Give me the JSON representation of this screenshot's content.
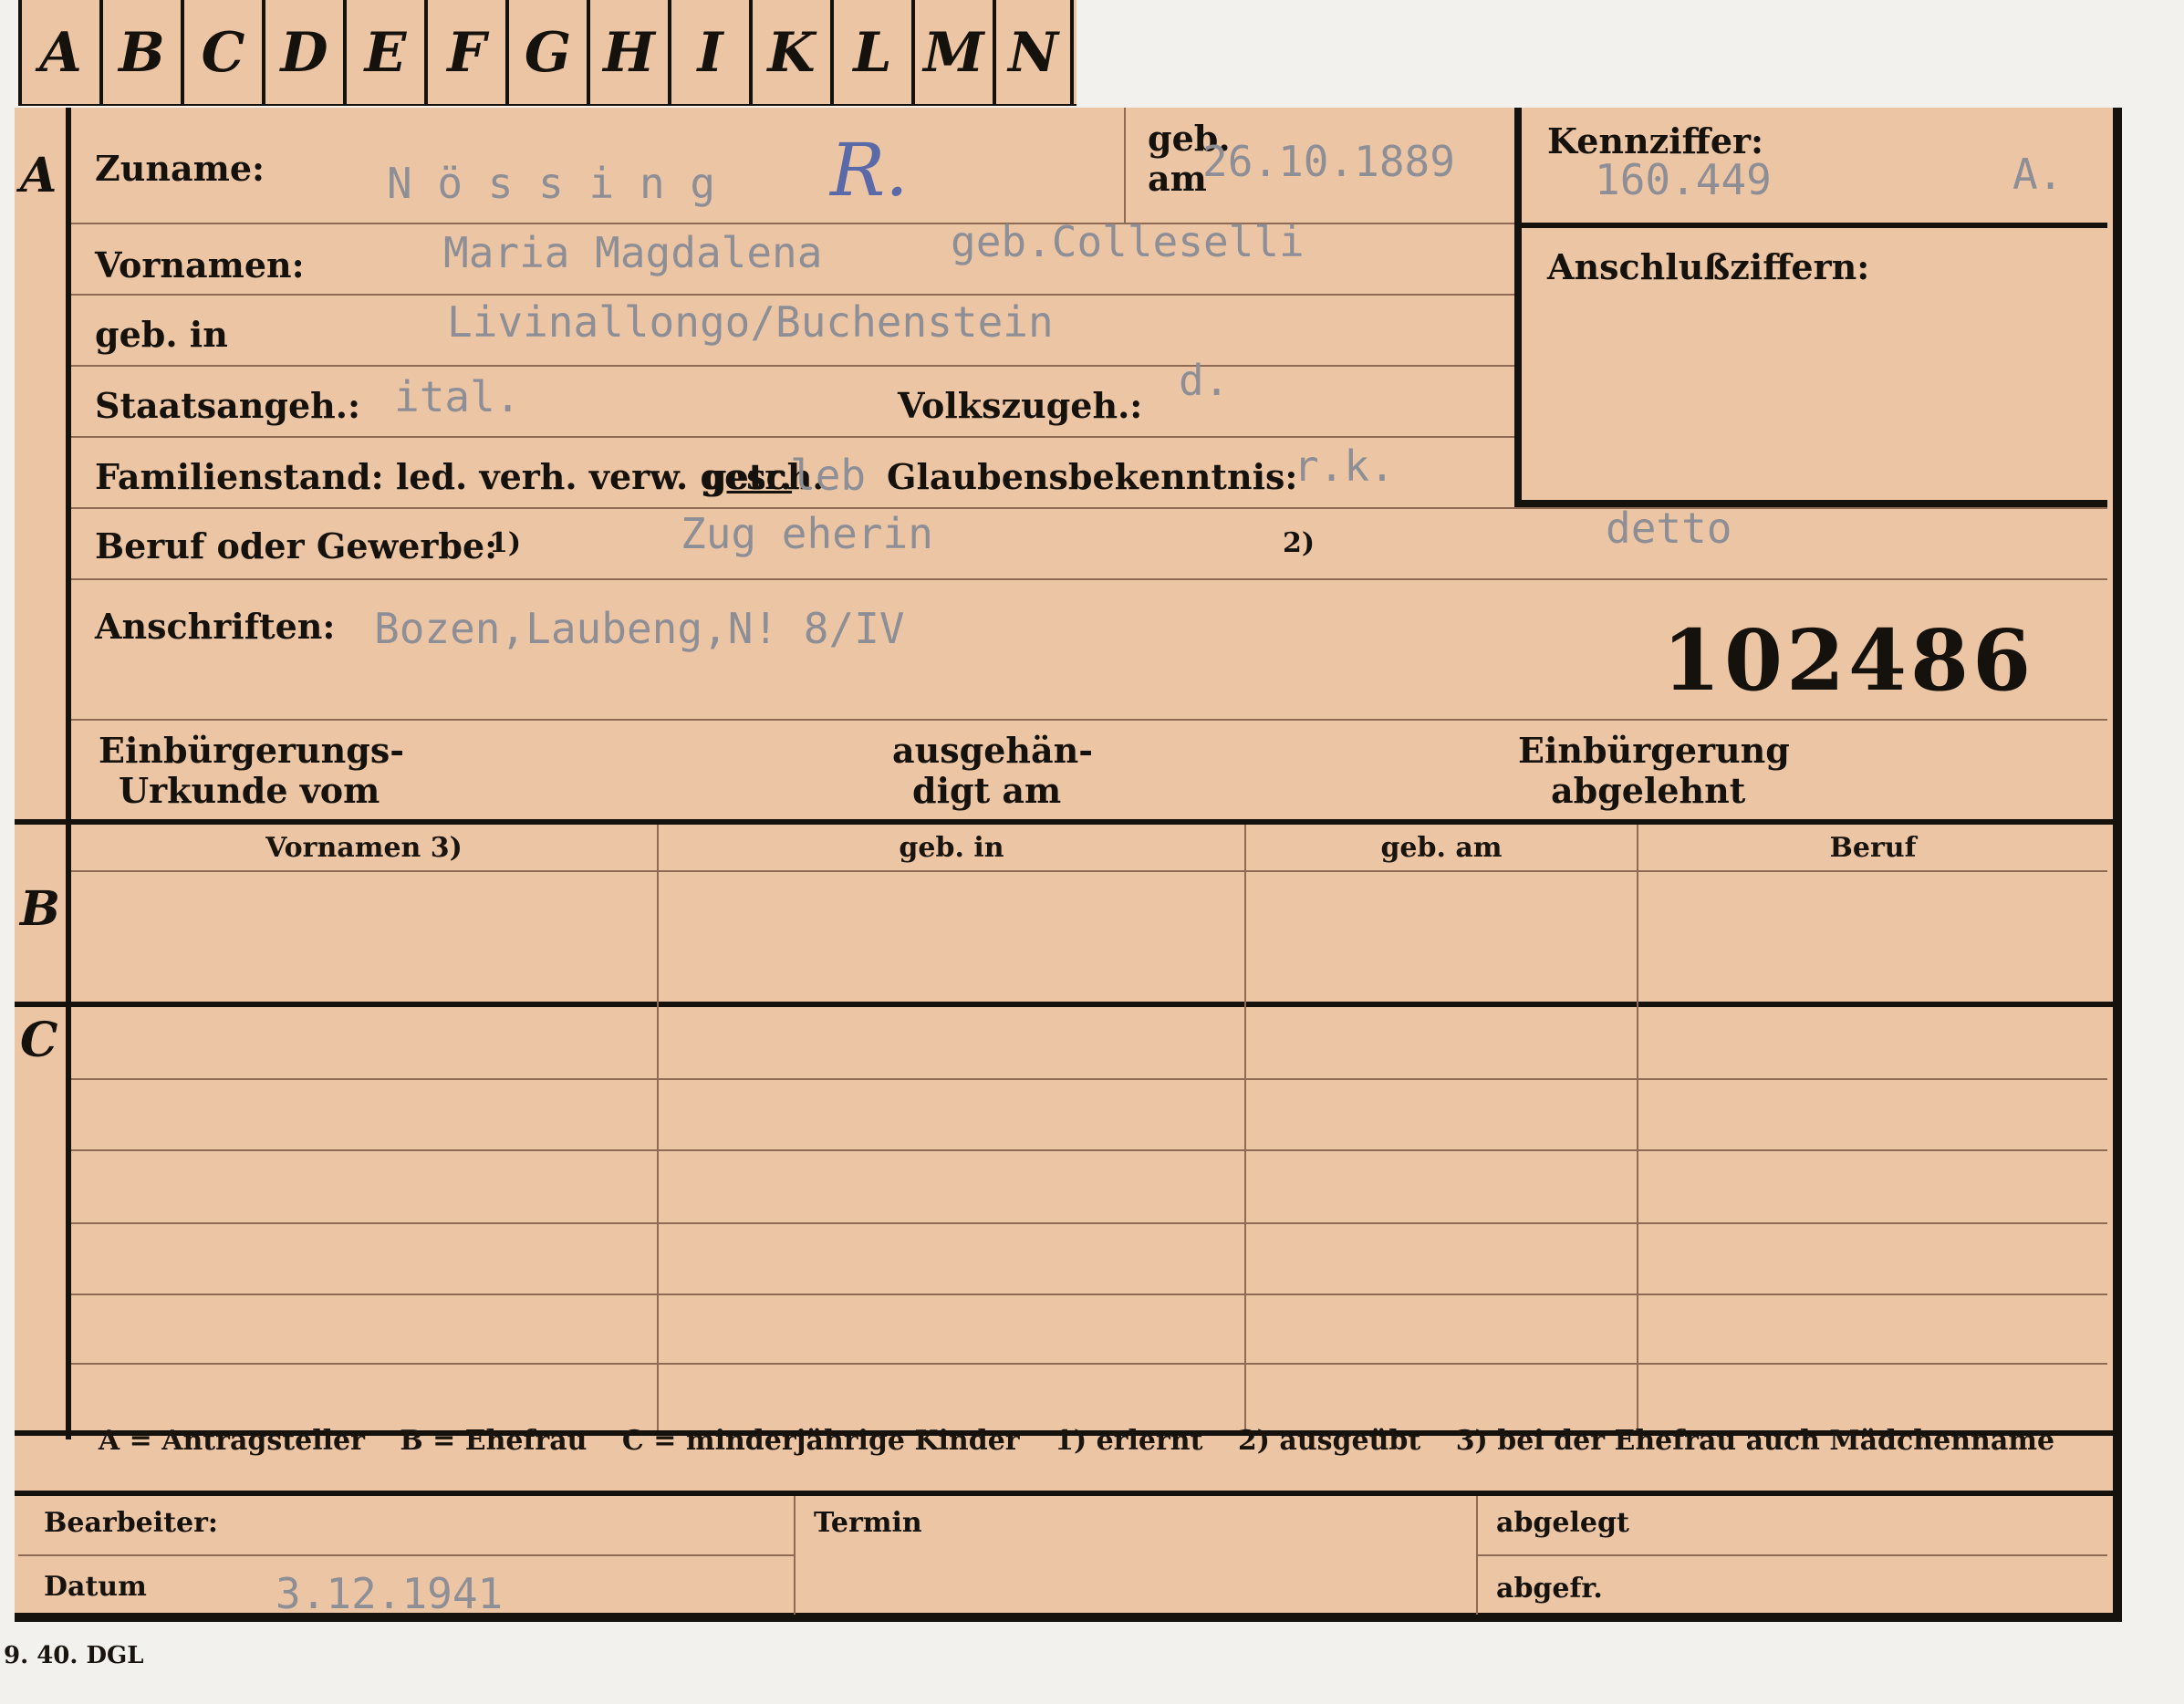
{
  "tabs": [
    "A",
    "B",
    "C",
    "D",
    "E",
    "F",
    "G",
    "H",
    "I",
    "K",
    "L",
    "M",
    "N"
  ],
  "sections": {
    "a": "A",
    "b": "B",
    "c": "C"
  },
  "labels": {
    "zuname": "Zuname:",
    "geb_am": "geb.\nam",
    "kennziffer": "Kennziffer:",
    "vornamen": "Vornamen:",
    "anschluss": "Anschlußziffern:",
    "geb_in": "geb. in",
    "staat": "Staatsangeh.:",
    "volks": "Volkszugeh.:",
    "familienstand": "Familienstand: led. verh. verw. gesch.",
    "getr": "getr.",
    "glauben": "Glaubensbekenntnis:",
    "beruf": "Beruf oder Gewerbe:",
    "beruf_note1": "1)",
    "beruf_note2": "2)",
    "anschriften": "Anschriften:",
    "einb_urkunde_1": "Einbürgerungs-",
    "einb_urkunde_2": "Urkunde vom",
    "ausgeh_1": "ausgehän-",
    "ausgeh_2": "digt am",
    "einb_abgel_1": "Einbürgerung",
    "einb_abgel_2": "abgelehnt",
    "bearbeiter": "Bearbeiter:",
    "termin": "Termin",
    "abgelegt": "abgelegt",
    "datum": "Datum",
    "abgefr": "abgefr."
  },
  "values": {
    "zuname": "N ö s s i n g",
    "stamp_mark": "R.",
    "geb_am": "26.10.1889",
    "kennziffer": "160.449",
    "kennziffer_suffix": "A.",
    "vornamen": "Maria Magdalena",
    "geb_name": "geb.Colleselli",
    "geb_in": "Livinallongo/Buchenstein",
    "staat": "ital.",
    "volks": "d.",
    "familienstand_extra": "leb",
    "glauben": "r.k.",
    "beruf1": "Zug eherin",
    "beruf2": "detto",
    "anschrift": "Bozen,Laubeng,N! 8/IV",
    "big_number": "102486",
    "datum": "3.12.1941"
  },
  "table_headers": [
    "Vornamen 3)",
    "geb. in",
    "geb. am",
    "Beruf"
  ],
  "legend": [
    "A = Antragsteller",
    "B = Ehefrau",
    "C = minderjährige Kinder",
    "1) erlernt",
    "2) ausgeübt",
    "3) bei der Ehefrau auch Mädchenname"
  ],
  "footer_code": "9. 40. DGL"
}
